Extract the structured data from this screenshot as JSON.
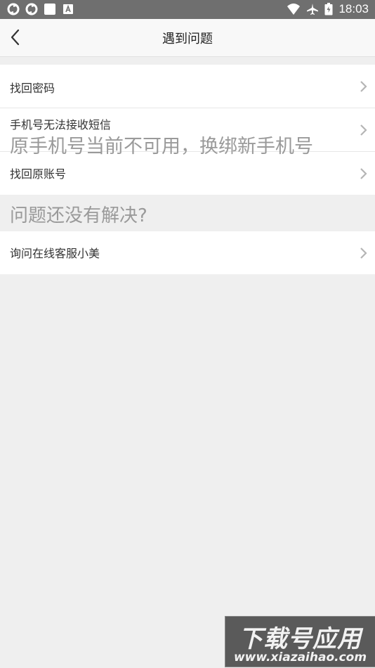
{
  "status_bar": {
    "time": "18:03",
    "left_icons": [
      "sync-icon",
      "sync-icon",
      "square-icon",
      "font-icon"
    ],
    "right_icons": [
      "wifi-icon",
      "airplane-icon",
      "battery-icon"
    ]
  },
  "nav": {
    "title": "遇到问题",
    "back_icon": "chevron-left-icon"
  },
  "rows_group1": [
    {
      "label": "找回密码"
    },
    {
      "label": "手机号无法接收短信"
    },
    {
      "label": "找回原账号"
    }
  ],
  "overlay_text": "原手机号当前不可用，换绑新手机号",
  "section_title": "问题还没有解决?",
  "rows_group2": [
    {
      "label": "询问在线客服小美"
    }
  ],
  "watermark": {
    "top": "下载号应用",
    "bottom": "www.xiazaihao.com"
  },
  "colors": {
    "status_bar": "#6f6f6f",
    "background": "#efefef",
    "row_bg": "#ffffff",
    "chevron": "#b5b5b5"
  }
}
